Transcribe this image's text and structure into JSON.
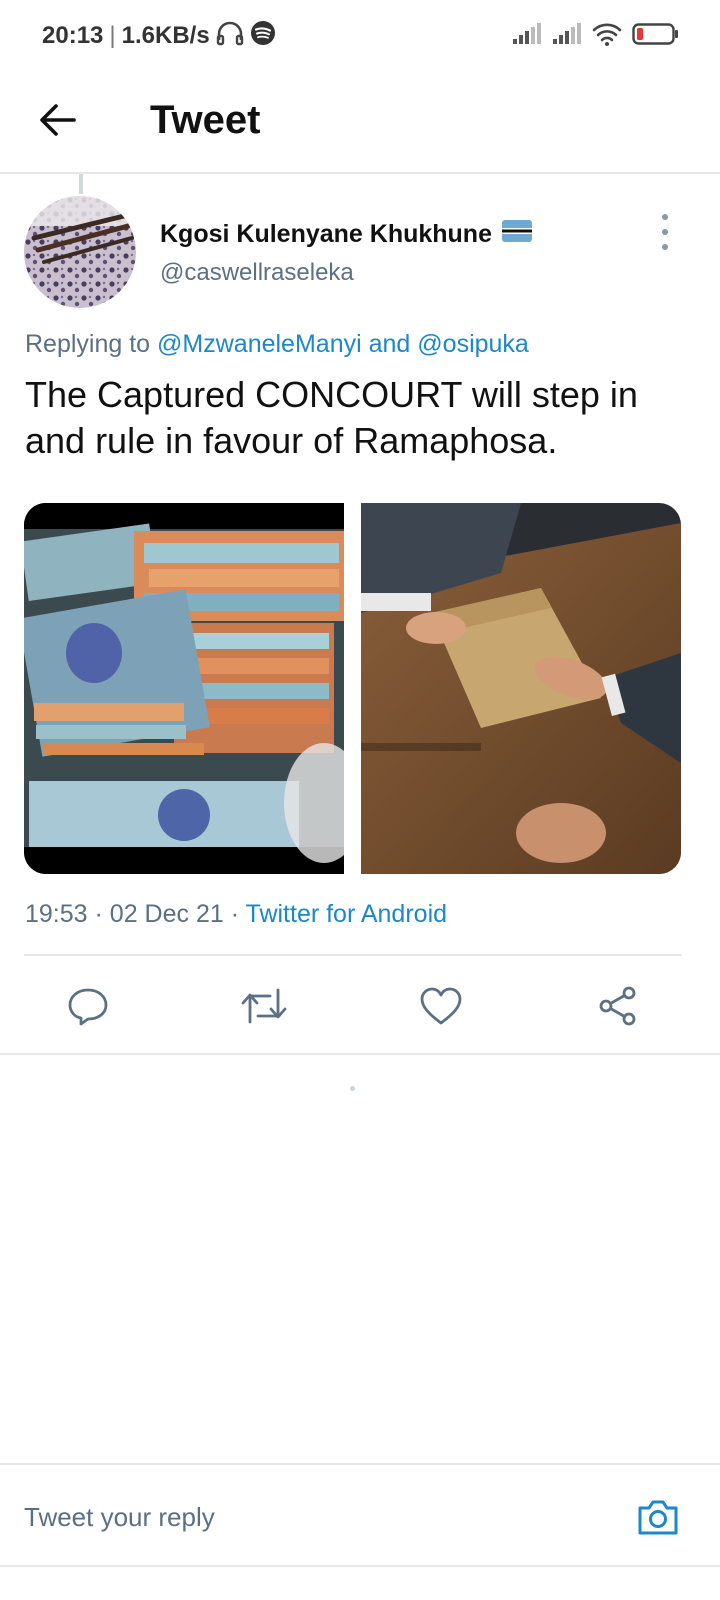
{
  "status_bar": {
    "time": "20:13",
    "speed": "1.6KB/s",
    "icons": [
      "headphones-icon",
      "spotify-icon",
      "signal-icon",
      "signal-icon",
      "wifi-icon",
      "battery-icon"
    ],
    "battery_color": "#e53935"
  },
  "header": {
    "title": "Tweet",
    "back_icon": "back-arrow-icon"
  },
  "tweet": {
    "author": {
      "display_name": "Kgosi Kulenyane Khukhune",
      "flag_icon": "botswana-flag-icon",
      "handle": "@caswellraseleka"
    },
    "replying_prefix": "Replying to",
    "replying_to_1": "@MzwaneleManyi",
    "replying_and": "and",
    "replying_to_2": "@osipuka",
    "text": "The Captured CONCOURT will step in and rule in favour of Ramaphosa.",
    "media": [
      "stacks-of-banknotes-photo",
      "envelope-handover-photo"
    ],
    "time": "19:53",
    "date": "02 Dec 21",
    "dot": "·",
    "source": "Twitter for Android"
  },
  "actions": [
    "reply-icon",
    "retweet-icon",
    "like-icon",
    "share-icon"
  ],
  "reply_bar": {
    "placeholder": "Tweet your reply",
    "camera_icon": "camera-icon"
  },
  "colors": {
    "link": "#1d87c8",
    "secondary": "#5b7083",
    "divider": "#e6e6e6"
  }
}
